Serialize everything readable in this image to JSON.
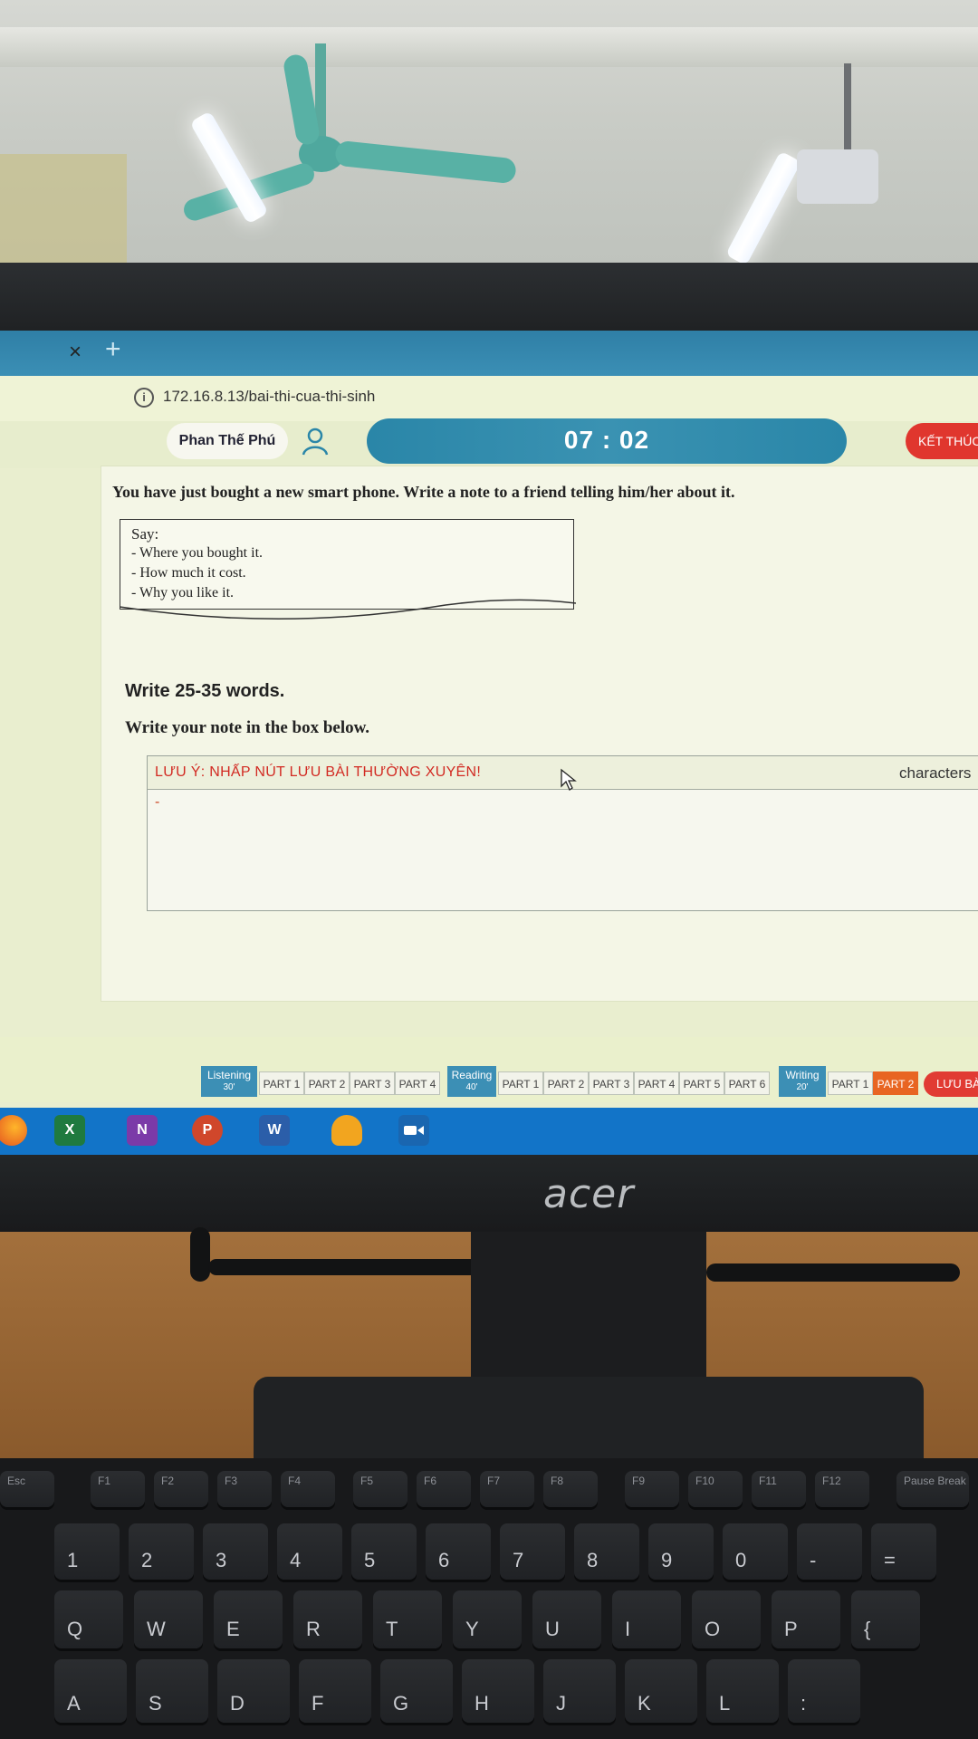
{
  "browser": {
    "tab_close": "×",
    "tab_new": "+",
    "url": "172.16.8.13/bai-thi-cua-thi-sinh",
    "info_icon": "i"
  },
  "exam": {
    "user_name": "Phan Thế Phú",
    "timer": "07 : 02",
    "end_button": "KẾT THÚC",
    "prompt": "You have just bought a new smart phone. Write a note to a friend telling him/her about it.",
    "say": {
      "title": "Say:",
      "items": [
        "- Where you bought it.",
        "- How much it cost.",
        "-  Why you like it."
      ]
    },
    "word_requirement": "Write 25-35 words.",
    "write_instruction": "Write your note in the box below.",
    "answer": {
      "warning": "LƯU Ý: NHẤP NÚT LƯU BÀI THƯỜNG XUYÊN!",
      "characters_label": "characters",
      "content": "-"
    }
  },
  "nav": {
    "sections": [
      {
        "title": "Listening",
        "time": "30'"
      },
      {
        "title": "Reading",
        "time": "40'"
      },
      {
        "title": "Writing",
        "time": "20'"
      }
    ],
    "listening_parts": [
      "PART 1",
      "PART 2",
      "PART 3",
      "PART 4"
    ],
    "reading_parts": [
      "PART 1",
      "PART 2",
      "PART 3",
      "PART 4",
      "PART 5",
      "PART 6"
    ],
    "writing_parts": [
      "PART 1",
      "PART 2"
    ],
    "active_part": "Writing PART 2",
    "save_button": "LƯU BÀ"
  },
  "taskbar": {
    "apps": [
      "firefox-icon",
      "excel-icon",
      "onenote-icon",
      "powerpoint-icon",
      "word-icon",
      "headset-icon",
      "video-icon"
    ],
    "labels": {
      "excel": "X",
      "onenote": "N",
      "powerpoint": "P",
      "word": "W"
    }
  },
  "monitor": {
    "brand": "acer"
  },
  "keyboard": {
    "fn_row": [
      "Esc",
      "F1",
      "F2",
      "F3",
      "F4",
      "F5",
      "F6",
      "F7",
      "F8",
      "F9",
      "F10",
      "F11",
      "F12",
      "Pause Break"
    ],
    "number_row": [
      "1",
      "2",
      "3",
      "4",
      "5",
      "6",
      "7",
      "8",
      "9",
      "0",
      "-",
      "="
    ],
    "top_row": [
      "Q",
      "W",
      "E",
      "R",
      "T",
      "Y",
      "U",
      "I",
      "O",
      "P",
      "{"
    ],
    "home_row": [
      "A",
      "S",
      "D",
      "F",
      "G",
      "H",
      "J",
      "K",
      "L",
      ":"
    ]
  },
  "colors": {
    "accent": "#3a8fb5",
    "end_button": "#e0362e",
    "active_part": "#e86522",
    "warning_text": "#d22a22",
    "taskbar": "#1274c8"
  }
}
